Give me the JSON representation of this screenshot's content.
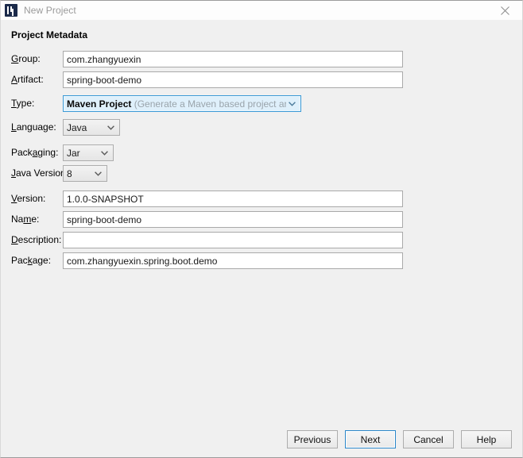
{
  "window": {
    "title": "New Project",
    "app_icon": "intellij-idea-icon",
    "close_icon": "close-icon"
  },
  "section": {
    "title": "Project Metadata"
  },
  "fields": {
    "group": {
      "label_pre": "",
      "label_mnemonic": "G",
      "label_post": "roup:",
      "value": "com.zhangyuexin"
    },
    "artifact": {
      "label_pre": "",
      "label_mnemonic": "A",
      "label_post": "rtifact:",
      "value": "spring-boot-demo"
    },
    "type": {
      "label_pre": "",
      "label_mnemonic": "T",
      "label_post": "ype:",
      "value_main": "Maven Project",
      "value_sub": "(Generate a Maven based project archive)",
      "chevron_icon": "chevron-down-icon"
    },
    "language": {
      "label_pre": "",
      "label_mnemonic": "L",
      "label_post": "anguage:",
      "value": "Java",
      "chevron_icon": "chevron-down-icon"
    },
    "packaging": {
      "label_pre": "Pack",
      "label_mnemonic": "a",
      "label_post": "ging:",
      "value": "Jar",
      "chevron_icon": "chevron-down-icon"
    },
    "java_version": {
      "label_pre": "",
      "label_mnemonic": "J",
      "label_post": "ava Version:",
      "value": "8",
      "chevron_icon": "chevron-down-icon"
    },
    "version": {
      "label_pre": "",
      "label_mnemonic": "V",
      "label_post": "ersion:",
      "value": "1.0.0-SNAPSHOT"
    },
    "name": {
      "label_pre": "Na",
      "label_mnemonic": "m",
      "label_post": "e:",
      "value": "spring-boot-demo"
    },
    "description": {
      "label_pre": "",
      "label_mnemonic": "D",
      "label_post": "escription:",
      "value": "",
      "placeholder": ""
    },
    "package": {
      "label_pre": "Pac",
      "label_mnemonic": "k",
      "label_post": "age:",
      "value": "com.zhangyuexin.spring.boot.demo"
    }
  },
  "buttons": {
    "previous": "Previous",
    "next": "Next",
    "cancel": "Cancel",
    "help": "Help"
  },
  "colors": {
    "dialog_bg": "#f0f0f0",
    "titlebar_bg": "#fdfdfd",
    "focus_blue": "#3c9ad6",
    "focus_fill": "#dff0fb",
    "default_button_border": "#2b87c9",
    "title_text": "#9a9a9a",
    "app_icon": "#1b2a4a"
  }
}
